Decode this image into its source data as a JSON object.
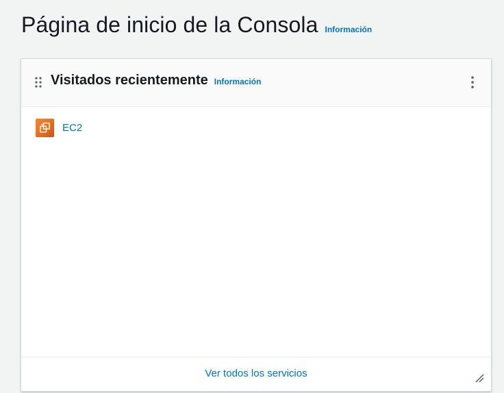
{
  "page": {
    "title": "Página de inicio de la Consola",
    "info_label": "Información"
  },
  "widget": {
    "title": "Visitados recientemente",
    "info_label": "Información",
    "drag_icon": "drag-handle-icon",
    "menu_icon": "kebab-menu-icon",
    "items": [
      {
        "label": "EC2",
        "icon": "ec2-service-icon",
        "icon_color": "#e3701d"
      }
    ],
    "footer_link": "Ver todos los servicios",
    "resize_icon": "resize-handle-icon"
  },
  "colors": {
    "background": "#f2f3f3",
    "link": "#0073bb",
    "text": "#16191f",
    "card": "#ffffff",
    "card_header": "#fafafa"
  }
}
